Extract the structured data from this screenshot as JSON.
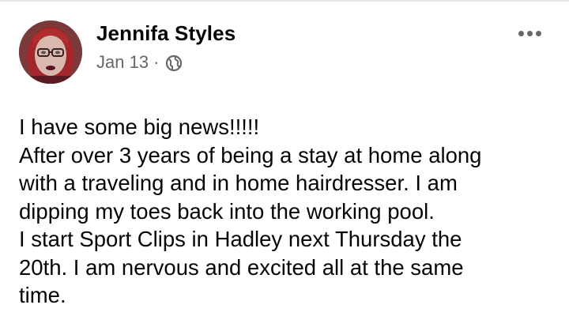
{
  "post": {
    "author": "Jennifa Styles",
    "date": "Jan 13",
    "separator": "·",
    "privacy_icon": "globe-icon",
    "more_icon": "more-options-icon",
    "text_lines": [
      "I have some big news!!!!!",
      "After over 3 years of being a stay at home along",
      "with a traveling and in home hairdresser. I am",
      "dipping my toes back into the working pool.",
      "I start Sport Clips in Hadley next Thursday the",
      "20th. I am nervous and excited all at the same",
      "time."
    ]
  },
  "colors": {
    "text_primary": "#050505",
    "text_secondary": "#65676b",
    "background": "#ffffff"
  }
}
